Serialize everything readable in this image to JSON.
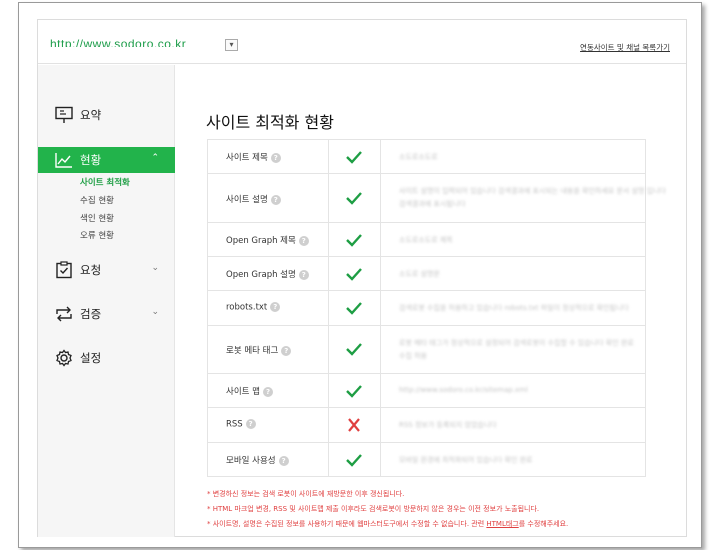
{
  "header": {
    "site_url": "http://www.sodoro.co.kr",
    "dropdown_icon": "chevron-down-icon",
    "site_link": "연동사이트 및 채널 목록가기"
  },
  "sidebar": {
    "items": [
      {
        "label": "요약",
        "icon": "presentation-icon"
      },
      {
        "label": "현황",
        "icon": "trend-chart-icon",
        "chevron": "⌃"
      },
      {
        "label": "요청",
        "icon": "clipboard-check-icon",
        "chevron": "⌄"
      },
      {
        "label": "검증",
        "icon": "refresh-arrows-icon",
        "chevron": "⌄"
      },
      {
        "label": "설정",
        "icon": "gear-icon"
      }
    ],
    "sub_items": [
      "사이트 최적화",
      "수집 현황",
      "색인 현황",
      "오류 현황"
    ]
  },
  "main": {
    "title": "사이트 최적화 현황",
    "rows": [
      {
        "label": "사이트 제목",
        "status": "ok",
        "value": "소도로소도로"
      },
      {
        "label": "사이트 설명",
        "status": "ok",
        "value": "사이트 설명이 입력되어 있습니다 검색결과에 표시되는 내용을 확인하세요 문서 설명 입니다",
        "value2": "검색결과에 표시됩니다"
      },
      {
        "label": "Open Graph 제목",
        "status": "ok",
        "value": "소도로소도로 제목"
      },
      {
        "label": "Open Graph 설명",
        "status": "ok",
        "value": "소도로 설명문"
      },
      {
        "label": "robots.txt",
        "status": "ok",
        "value": "검색로봇 수집을 허용하고 있습니다 robots.txt 파일이 정상적으로 확인됩니다"
      },
      {
        "label": "로봇 메타 태그",
        "status": "ok",
        "value": "로봇 메타 태그가 정상적으로 설정되어 검색로봇이 수집할 수 있습니다 확인 완료",
        "value2": "수집 허용"
      },
      {
        "label": "사이트 맵",
        "status": "ok",
        "value": "http://www.sodoro.co.kr/sitemap.xml"
      },
      {
        "label": "RSS",
        "status": "fail",
        "value": "RSS 정보가 등록되지 않았습니다"
      },
      {
        "label": "모바일 사용성",
        "status": "ok",
        "value": "모바일 환경에 최적화되어 있습니다 확인 완료"
      }
    ],
    "help_glyph": "?",
    "notes": [
      "* 변경하신 정보는 검색 로봇이 사이트에 재방문한 이후 갱신됩니다.",
      "* HTML 마크업 변경, RSS 및 사이트맵 제출 이후라도 검색로봇이 방문하지 않은 경우는 이전 정보가 노출됩니다.",
      "* 사이트명, 설명은 수집된 정보를 사용하기 때문에 웹마스터도구에서 수정할 수 없습니다. 관련 ",
      "HTML태그",
      "를 수정해주세요."
    ]
  },
  "colors": {
    "accent": "#22b34b",
    "check": "#1e9e44",
    "cross": "#e04040"
  }
}
